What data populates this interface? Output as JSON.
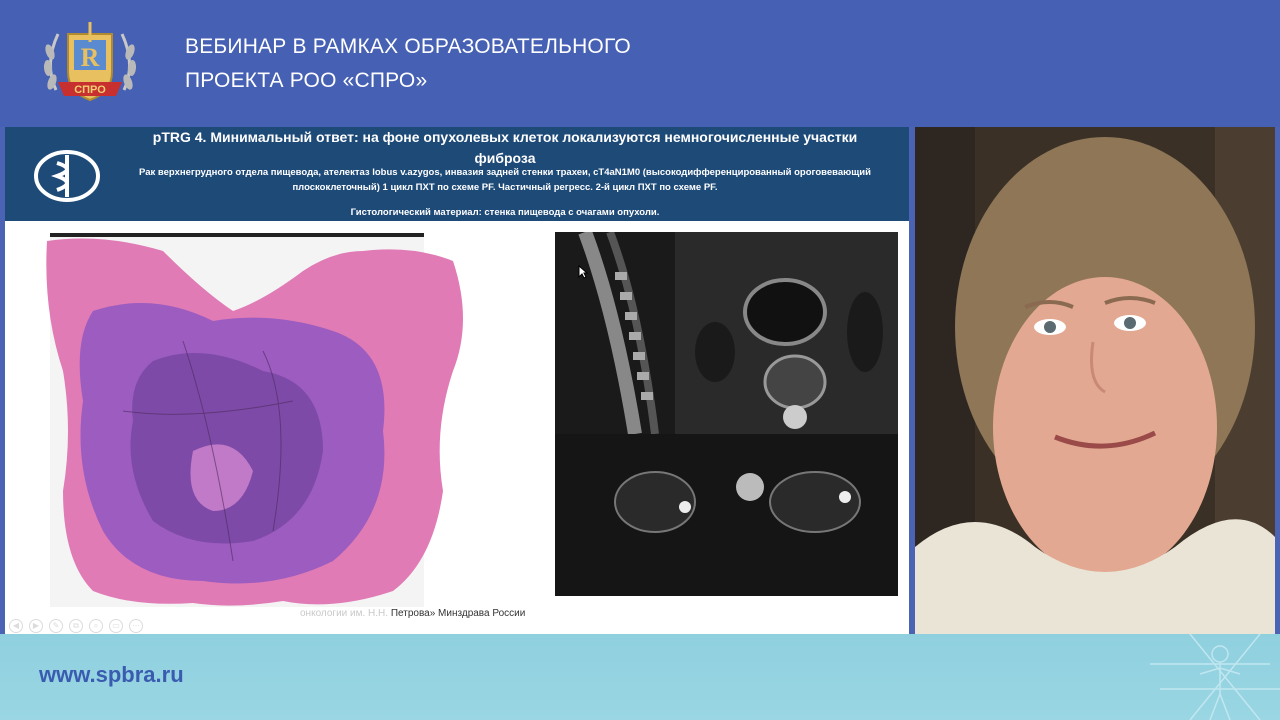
{
  "header": {
    "title_line1": "Вебинар в рамках образовательного",
    "title_line2": "проекта РОО «СПРО»",
    "logo": {
      "letter": "R",
      "ribbon": "СПРО"
    }
  },
  "slide": {
    "title_line1": "pTRG 4. Минимальный ответ: на фоне опухолевых клеток локализуются немногочисленные участки",
    "title_line2": "фиброза",
    "subtitle_line1": "Рак верхнегрудного отдела пищевода, ателектаз lobus v.azygos, инвазия задней стенки трахеи, cT4aN1M0 (высокодифференцированный ороговевающий",
    "subtitle_line2": "плоскоклеточный) 1 цикл ПХТ по схеме PF. Частичный регресс. 2-й цикл ПХТ по схеме PF.",
    "histo_label": "Гистологический материал: стенка пищевода с очагами опухоли.",
    "footer_faded": "онкологии им. Н.Н.",
    "footer_dark": "Петрова» Минздрава России",
    "controls": [
      "◀",
      "▶",
      "✎",
      "⧉",
      "⌕",
      "▭",
      "⋯"
    ]
  },
  "footer": {
    "url": "www.spbra.ru"
  },
  "colors": {
    "header_bg": "#4660b3",
    "slide_header_bg": "#1e4a78",
    "footer_bg": "#9ad6e3",
    "url_color": "#3a5cb0"
  }
}
